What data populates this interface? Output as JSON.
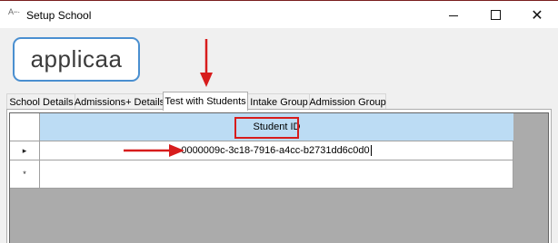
{
  "window": {
    "app_icon": "A−·",
    "title": "Setup School",
    "minimize_icon": "minimize-icon",
    "maximize_icon": "maximize-icon",
    "close_glyph": "✕"
  },
  "logo": {
    "text": "applicaa"
  },
  "tabs": [
    {
      "label": "School Details",
      "active": false
    },
    {
      "label": "Admissions+ Details",
      "active": false
    },
    {
      "label": "Test with Students",
      "active": true
    },
    {
      "label": "Intake Group",
      "active": false
    },
    {
      "label": "Admission Group",
      "active": false
    }
  ],
  "grid": {
    "columns": [
      "Student ID"
    ],
    "rows": [
      {
        "indicator": "▸",
        "student_id": "0000009c-3c18-7916-a4cc-b2731dd6c0d0",
        "editing": true
      },
      {
        "indicator": "*",
        "student_id": "",
        "new_row": true
      }
    ]
  },
  "annotations": {
    "color": "#d71c1c",
    "arrows": [
      "down-arrow-to-tab",
      "right-arrow-to-value"
    ],
    "highlight": "student-id-header"
  },
  "colors": {
    "header_bg": "#bcdcf4",
    "grid_bg": "#ababab",
    "logo_border": "#4a8fd0"
  }
}
